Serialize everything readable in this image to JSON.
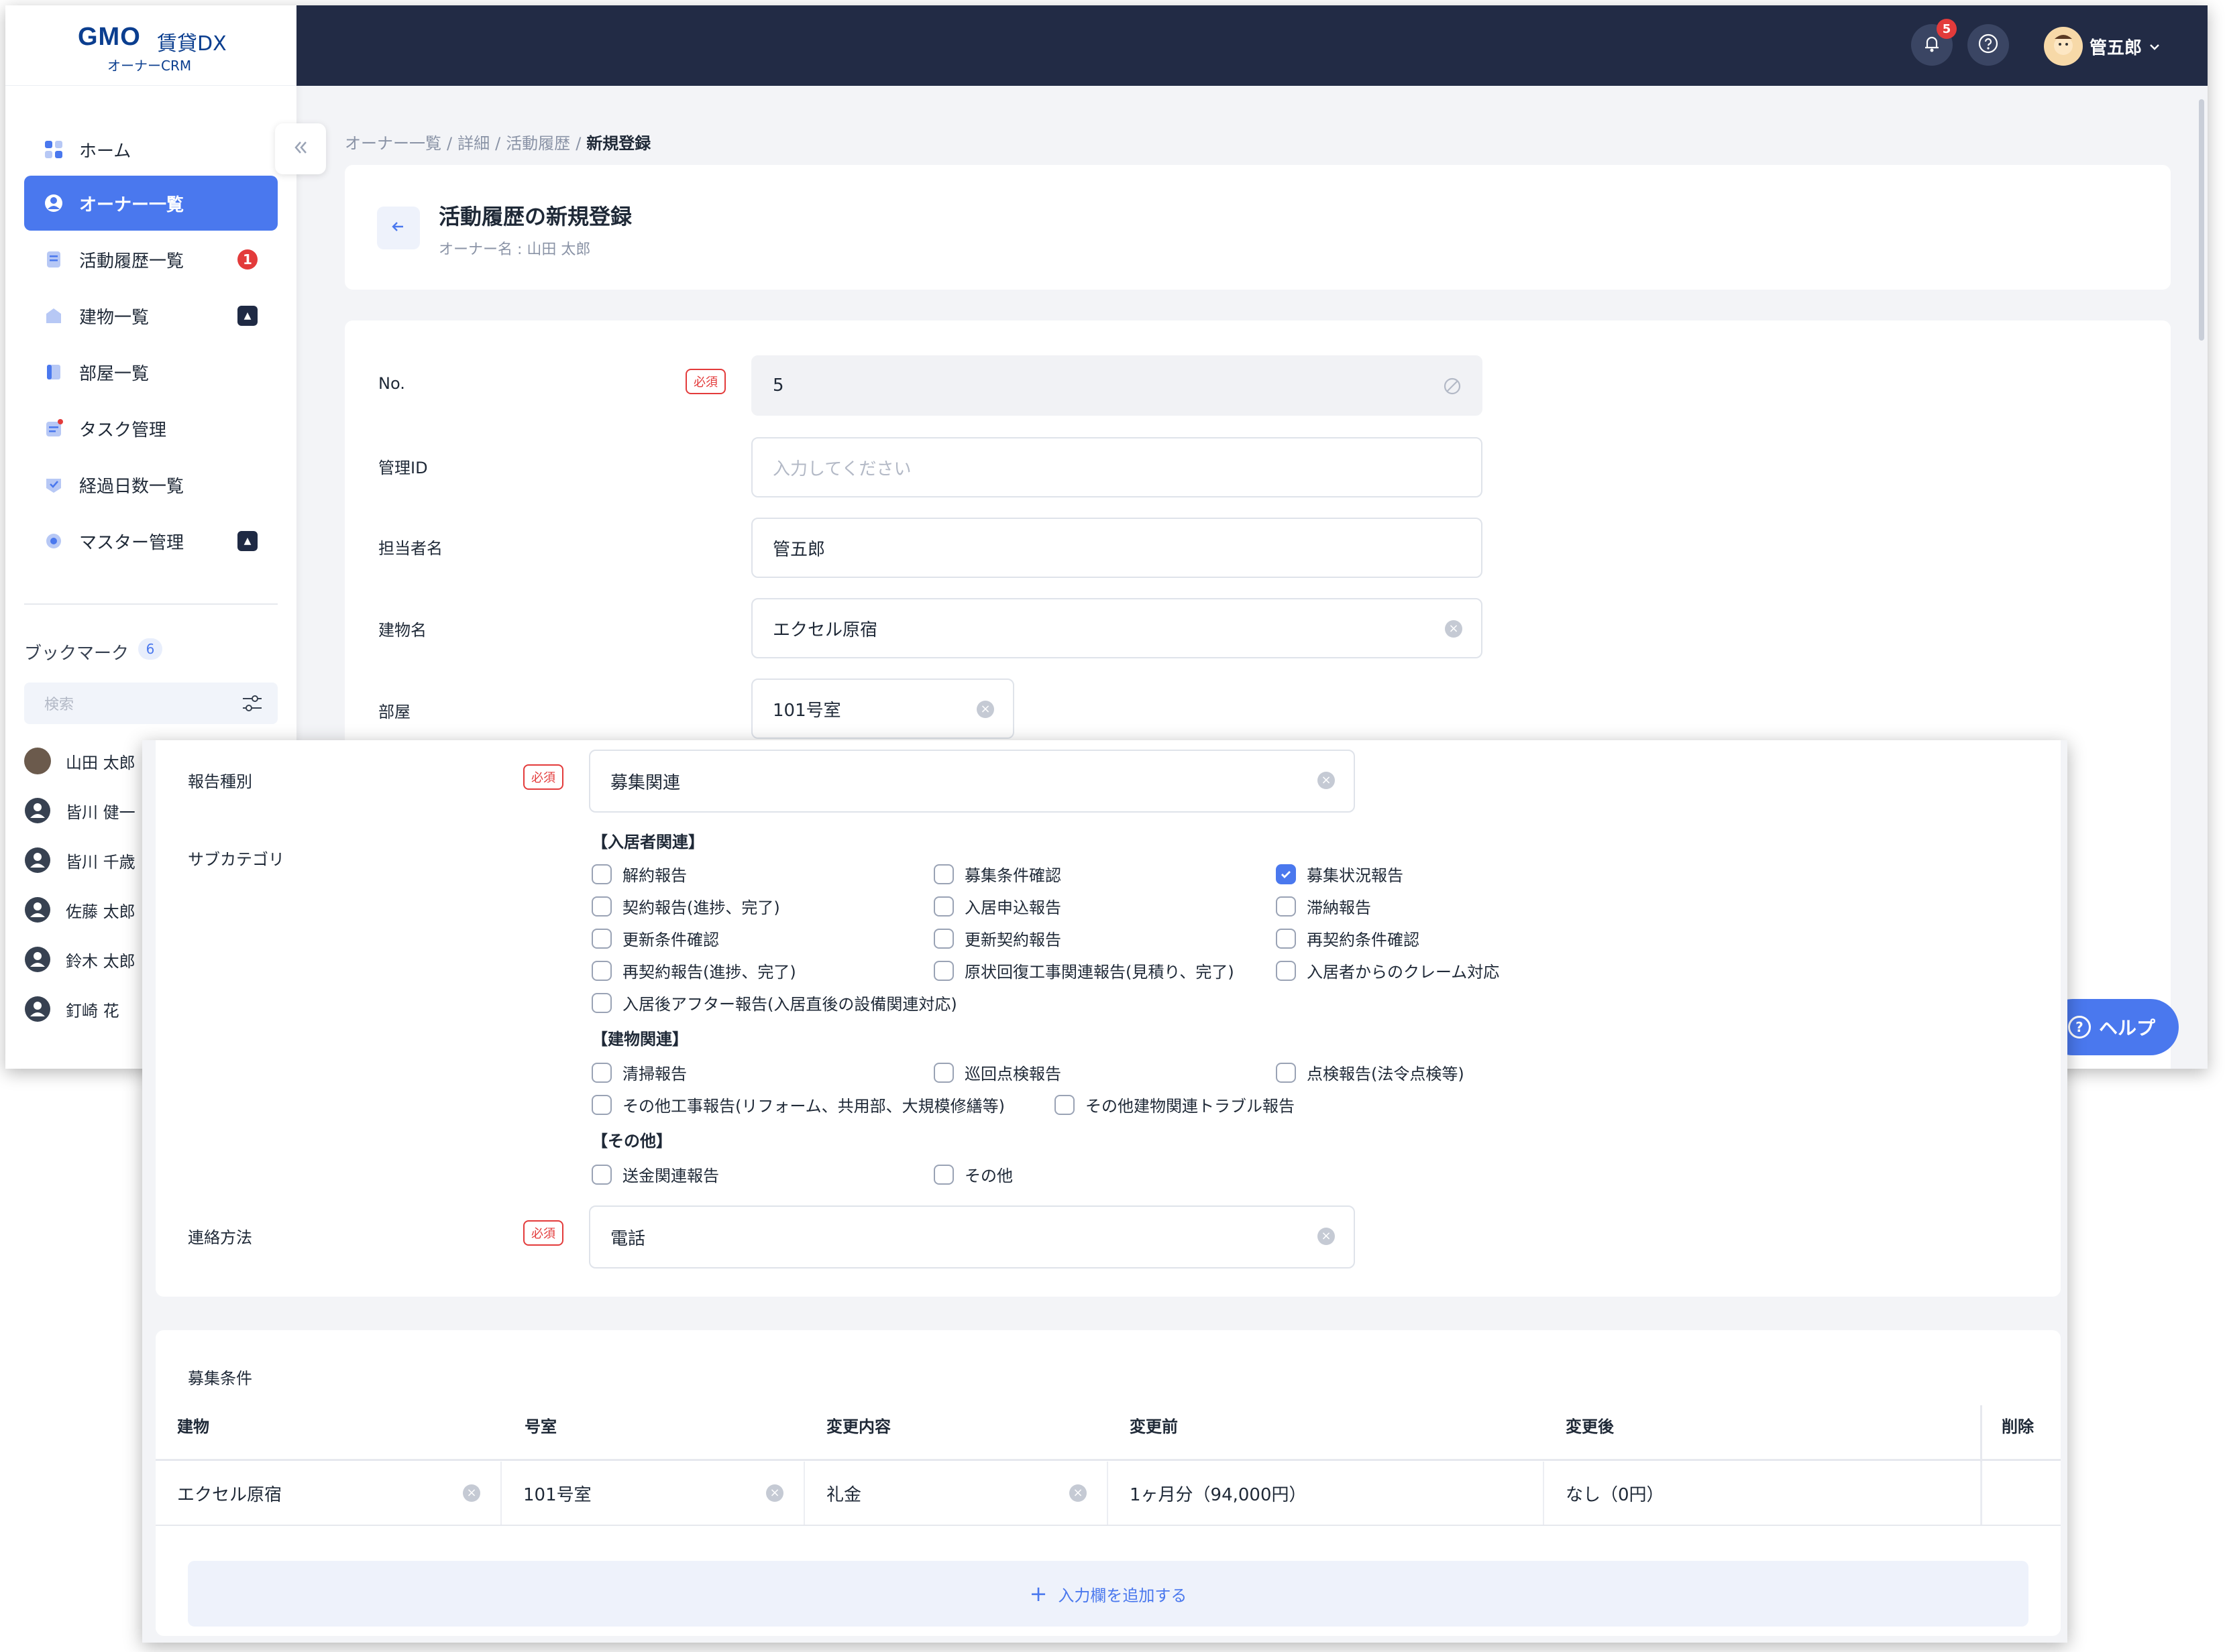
{
  "logo": {
    "brand": "GMO",
    "product": "賃貸DX",
    "sub": "オーナーCRM"
  },
  "sidebar": {
    "items": [
      {
        "label": "ホーム",
        "icon": "home-icon",
        "active": false,
        "badge": "",
        "expand": false
      },
      {
        "label": "オーナー一覧",
        "icon": "owner-icon",
        "active": true,
        "badge": "",
        "expand": false
      },
      {
        "label": "活動履歴一覧",
        "icon": "activity-icon",
        "active": false,
        "badge": "1",
        "expand": false
      },
      {
        "label": "建物一覧",
        "icon": "building-icon",
        "active": false,
        "badge": "",
        "expand": true
      },
      {
        "label": "部屋一覧",
        "icon": "room-icon",
        "active": false,
        "badge": "",
        "expand": false
      },
      {
        "label": "タスク管理",
        "icon": "task-icon",
        "active": false,
        "badge": "",
        "expand": false
      },
      {
        "label": "経過日数一覧",
        "icon": "days-icon",
        "active": false,
        "badge": "",
        "expand": false
      },
      {
        "label": "マスター管理",
        "icon": "master-icon",
        "active": false,
        "badge": "",
        "expand": true
      }
    ],
    "bookmark": {
      "title": "ブックマーク",
      "count": "6",
      "search_placeholder": "検索",
      "items": [
        "山田 太郎",
        "皆川 健一",
        "皆川 千歳",
        "佐藤 太郎",
        "鈴木 太郎",
        "釘崎 花"
      ]
    }
  },
  "topbar": {
    "notification_count": "5",
    "user_name": "管五郎"
  },
  "breadcrumb": [
    "オーナー一覧",
    "詳細",
    "活動履歴",
    "新規登録"
  ],
  "header": {
    "title": "活動履歴の新規登録",
    "subtitle": "オーナー名 : 山田 太郎"
  },
  "form": {
    "required_label": "必須",
    "no": {
      "label": "No.",
      "value": "5"
    },
    "manage_id": {
      "label": "管理ID",
      "placeholder": "入力してください"
    },
    "staff": {
      "label": "担当者名",
      "value": "管五郎"
    },
    "building": {
      "label": "建物名",
      "value": "エクセル原宿"
    },
    "room": {
      "label": "部屋",
      "value": "101号室"
    },
    "report_type": {
      "label": "報告種別",
      "value": "募集関連"
    },
    "subcategory": {
      "label": "サブカテゴリ",
      "groups": [
        {
          "heading": "【入居者関連】",
          "options": [
            "解約報告",
            "募集条件確認",
            "募集状況報告",
            "契約報告(進捗、完了)",
            "入居申込報告",
            "滞納報告",
            "更新条件確認",
            "更新契約報告",
            "再契約条件確認",
            "再契約報告(進捗、完了)",
            "原状回復工事関連報告(見積り、完了)",
            "入居者からのクレーム対応",
            "入居後アフター報告(入居直後の設備関連対応)"
          ]
        },
        {
          "heading": "【建物関連】",
          "options": [
            "清掃報告",
            "巡回点検報告",
            "点検報告(法令点検等)",
            "その他工事報告(リフォーム、共用部、大規模修繕等)",
            "その他建物関連トラブル報告"
          ]
        },
        {
          "heading": "【その他】",
          "options": [
            "送金関連報告",
            "その他"
          ]
        }
      ],
      "checked": "募集状況報告"
    },
    "contact": {
      "label": "連絡方法",
      "value": "電話"
    }
  },
  "recruit": {
    "title": "募集条件",
    "columns": [
      "建物",
      "号室",
      "変更内容",
      "変更前",
      "変更後",
      "削除"
    ],
    "rows": [
      {
        "building": "エクセル原宿",
        "room": "101号室",
        "change": "礼金",
        "before": "1ヶ月分（94,000円）",
        "after": "なし（0円）"
      }
    ],
    "add_label": "入力欄を追加する"
  },
  "help_button": "ヘルプ",
  "colors": {
    "accent": "#4a78ee",
    "topbar": "#222b45",
    "danger": "#e33b3b"
  }
}
